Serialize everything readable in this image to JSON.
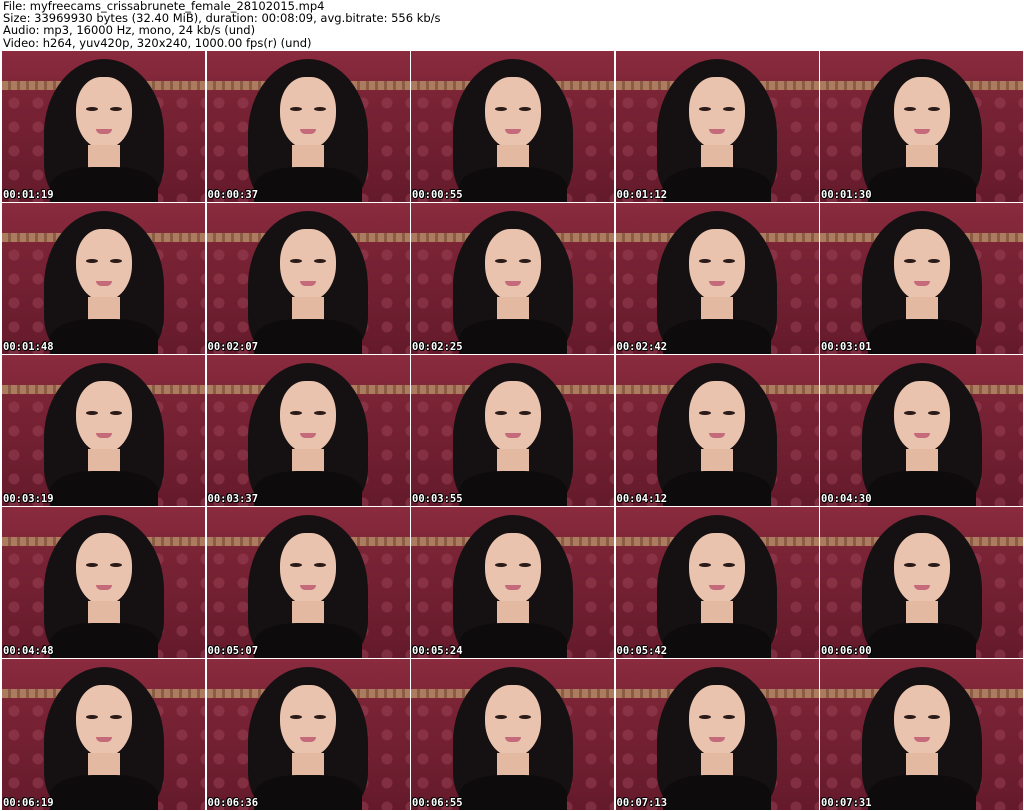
{
  "header": {
    "file_line": "File: myfreecams_crissabrunete_female_28102015.mp4",
    "size_line": "Size: 33969930 bytes (32.40 MiB), duration: 00:08:09, avg.bitrate: 556 kb/s",
    "audio_line": "Audio: mp3, 16000 Hz, mono, 24 kb/s (und)",
    "video_line": "Video: h264, yuv420p, 320x240, 1000.00 fps(r) (und)"
  },
  "thumbnails": [
    {
      "timestamp": "00:01:19"
    },
    {
      "timestamp": "00:00:37"
    },
    {
      "timestamp": "00:00:55"
    },
    {
      "timestamp": "00:01:12"
    },
    {
      "timestamp": "00:01:30"
    },
    {
      "timestamp": "00:01:48"
    },
    {
      "timestamp": "00:02:07"
    },
    {
      "timestamp": "00:02:25"
    },
    {
      "timestamp": "00:02:42"
    },
    {
      "timestamp": "00:03:01"
    },
    {
      "timestamp": "00:03:19"
    },
    {
      "timestamp": "00:03:37"
    },
    {
      "timestamp": "00:03:55"
    },
    {
      "timestamp": "00:04:12"
    },
    {
      "timestamp": "00:04:30"
    },
    {
      "timestamp": "00:04:48"
    },
    {
      "timestamp": "00:05:07"
    },
    {
      "timestamp": "00:05:24"
    },
    {
      "timestamp": "00:05:42"
    },
    {
      "timestamp": "00:06:00"
    },
    {
      "timestamp": "00:06:19"
    },
    {
      "timestamp": "00:06:36"
    },
    {
      "timestamp": "00:06:55"
    },
    {
      "timestamp": "00:07:13"
    },
    {
      "timestamp": "00:07:31"
    }
  ],
  "colors": {
    "background": "#ffffff",
    "wall": "#7a2234",
    "timestamp_text": "#ffffff"
  }
}
